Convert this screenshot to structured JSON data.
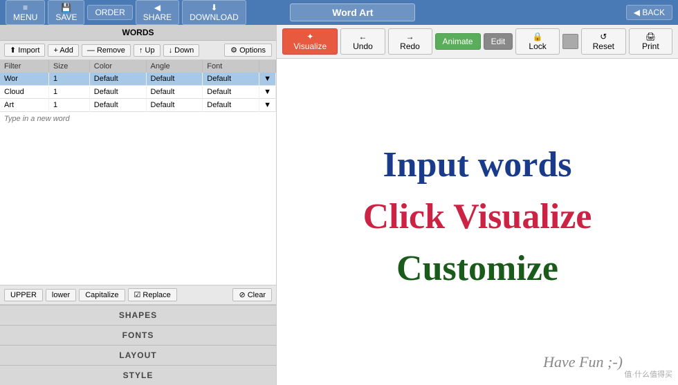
{
  "topbar": {
    "menu_label": "≡ MENU",
    "save_label": "💾 SAVE",
    "order_label": "ORDER",
    "share_label": "◀ SHARE",
    "download_label": "⬇ DOWNLOAD",
    "title": "Word Art",
    "back_label": "◀ BACK"
  },
  "left_panel": {
    "header": "WORDS",
    "import_label": "⬆ Import",
    "add_label": "+ Add",
    "remove_label": "— Remove",
    "up_label": "↑ Up",
    "down_label": "↓ Down",
    "options_label": "⚙ Options",
    "table_headers": [
      "Filter",
      "Size",
      "Color",
      "Angle",
      "Font"
    ],
    "words": [
      {
        "word": "Wor",
        "size": "1",
        "color": "Default",
        "angle": "Default",
        "font": "Default"
      },
      {
        "word": "Cloud",
        "size": "1",
        "color": "Default",
        "angle": "Default",
        "font": "Default"
      },
      {
        "word": "Art",
        "size": "1",
        "color": "Default",
        "angle": "Default",
        "font": "Default"
      }
    ],
    "new_word_placeholder": "Type in a new word",
    "case_upper": "UPPER",
    "case_lower": "lower",
    "case_capitalize": "Capitalize",
    "case_replace": "☑ Replace",
    "clear_label": "⊘ Clear",
    "section_shapes": "SHAPES",
    "section_fonts": "FONTS",
    "section_layout": "LAYOUT",
    "section_style": "STYLE"
  },
  "right_toolbar": {
    "visualize_label": "✦ Visualize",
    "undo_label": "← Undo",
    "redo_label": "→ Redo",
    "animate_label": "Animate",
    "edit_label": "Edit",
    "lock_label": "🔒 Lock",
    "reset_label": "↺ Reset",
    "print_label": "🖨 Print"
  },
  "canvas": {
    "line1": "Input words",
    "line2": "Click Visualize",
    "line3": "Customize",
    "fun_text": "Have Fun ;-)"
  },
  "watermark": "值·什么值得买"
}
